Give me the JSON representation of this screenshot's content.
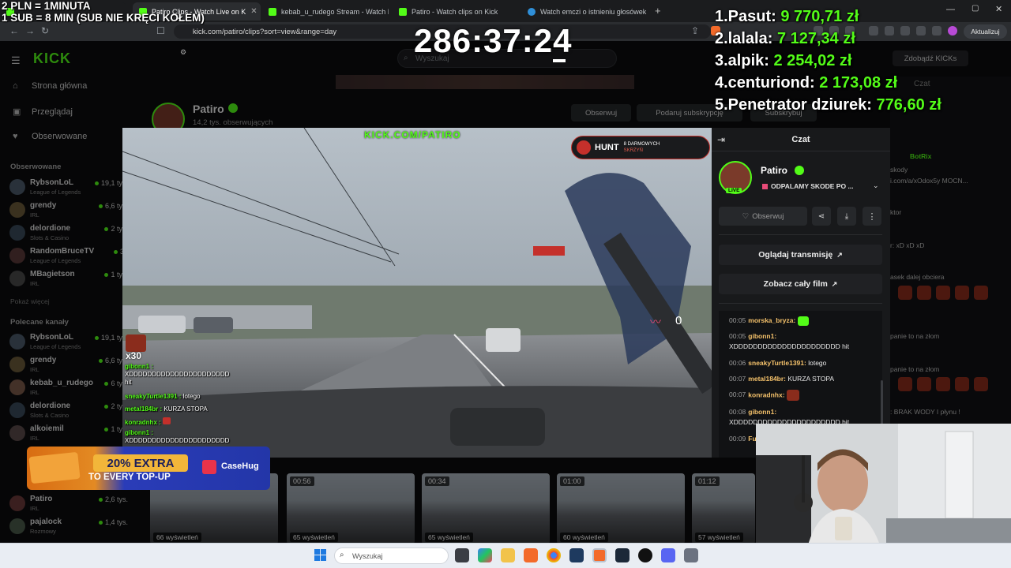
{
  "overlay": {
    "line1": "2 PLN =  1MINUTA",
    "line2": "1 SUB = 8 MIN (SUB NIE KRĘCI KOŁEM)",
    "timer": "286:37:24"
  },
  "leaderboard": [
    {
      "name": "1.Pasut:",
      "amount": "9 770,71 zł"
    },
    {
      "name": "2.lalala:",
      "amount": "7 127,34 zł"
    },
    {
      "name": "3.alpik:",
      "amount": "2 254,02 zł"
    },
    {
      "name": "4.centuriond:",
      "amount": "2 173,08 zł"
    },
    {
      "name": "5.Penetrator dziurek:",
      "amount": "776,60 zł"
    }
  ],
  "browser": {
    "tabs": [
      {
        "label": "Patiro Clips - Watch Live on K",
        "active": true
      },
      {
        "label": "kebab_u_rudego Stream - Watch Live",
        "active": false
      },
      {
        "label": "Patiro - Watch clips on Kick",
        "active": false
      },
      {
        "label": "Watch emczi o istnieniu głosówek | St",
        "active": false
      }
    ],
    "url": "kick.com/patiro/clips?sort=view&range=day",
    "update_label": "Aktualizuj"
  },
  "kick": {
    "logo": "KICK",
    "search_placeholder": "Wyszukaj",
    "nav": [
      {
        "label": "Strona główna",
        "icon": "home-icon"
      },
      {
        "label": "Przeglądaj",
        "icon": "browse-icon"
      },
      {
        "label": "Obserwowane",
        "icon": "heart-icon"
      }
    ],
    "followed_heading": "Obserwowane",
    "followed": [
      {
        "name": "RybsonLoL",
        "game": "League of Legends",
        "viewers": "19,1 tys."
      },
      {
        "name": "grendy",
        "game": "IRL",
        "viewers": "6,6 tys."
      },
      {
        "name": "delordione",
        "game": "Slots & Casino",
        "viewers": "2 tys."
      },
      {
        "name": "RandomBruceTV",
        "game": "League of Legends",
        "viewers": "31"
      },
      {
        "name": "MBagietson",
        "game": "IRL",
        "viewers": "1 tys."
      }
    ],
    "show_more": "Pokaż więcej",
    "recommended_heading": "Polecane kanały",
    "recommended": [
      {
        "name": "RybsonLoL",
        "game": "League of Legends",
        "viewers": "19,1 tys."
      },
      {
        "name": "grendy",
        "game": "IRL",
        "viewers": "6,6 tys."
      },
      {
        "name": "kebab_u_rudego",
        "game": "IRL",
        "viewers": "6 tys."
      },
      {
        "name": "delordione",
        "game": "Slots & Casino",
        "viewers": "2 tys."
      },
      {
        "name": "alkoiemil",
        "game": "IRL",
        "viewers": "1 tys."
      },
      {
        "name": "Patiro",
        "game": "IRL",
        "viewers": "2,6 tys."
      },
      {
        "name": "pajalock",
        "game": "Rozmowy",
        "viewers": "1,4 tys."
      }
    ],
    "streamer_name": "Patiro",
    "streamer_followers": "14,2 tys. obserwujących",
    "bg_follow": "Obserwuj",
    "bg_gift": "Podaruj subskrypcję",
    "bg_subscribe": "Subskrybuj",
    "get_kicks": "Zdobądź KICKs",
    "clips": [
      {
        "duration": "",
        "views": "66 wyświetleń"
      },
      {
        "duration": "00:56",
        "views": "65 wyświetleń"
      },
      {
        "duration": "00:34",
        "views": "65 wyświetleń"
      },
      {
        "duration": "01:00",
        "views": "60 wyświetleń"
      },
      {
        "duration": "01:12",
        "views": "57 wyświetleń"
      }
    ]
  },
  "clip_modal": {
    "watermark": "KICK.COM/PATIRO",
    "hunt_label": "HUNT",
    "hunt_sub1": "8 DARMOWYCH",
    "hunt_sub2": "SKRZYŃ",
    "pulse_count": "0",
    "x30": "x30",
    "panel_title": "Czat",
    "channel_name": "Patiro",
    "live_badge": "LIVE",
    "stream_title": "ODPALAMY SKODE PO ...",
    "follow_label": "Obserwuj",
    "watch_stream": "Oglądaj transmisję",
    "watch_full": "Zobacz cały film",
    "messages": [
      {
        "time": "00:05",
        "user": "morska_bryza:",
        "color": "#f5c26b",
        "text": ""
      },
      {
        "time": "00:05",
        "user": "gibonn1:",
        "color": "#f5c26b",
        "text": "XDDDDDDDDDDDDDDDDDDDDDD hit"
      },
      {
        "time": "00:06",
        "user": "sneakyTurtle1391:",
        "color": "#f5c26b",
        "text": "lotego"
      },
      {
        "time": "00:07",
        "user": "metal184br:",
        "color": "#f5c26b",
        "text": "KURZA STOPA"
      },
      {
        "time": "00:07",
        "user": "konradnhx:",
        "color": "#f5c26b",
        "text": ""
      },
      {
        "time": "00:08",
        "user": "gibonn1:",
        "color": "#f5c26b",
        "text": "XDDDDDDDDDDDDDDDDDDDDDD hit"
      },
      {
        "time": "00:09",
        "user": "Fu",
        "color": "#f5c26b",
        "text": ""
      }
    ],
    "overlay_chat": [
      {
        "user": "gibonn1 :",
        "color": "#53fc18",
        "text": "XDDDDDDDDDDDDDDDDDDDDDD hit"
      },
      {
        "user": "sneakyTurtle1391 :",
        "color": "#53fc18",
        "text": "lotego"
      },
      {
        "user": "metal184br :",
        "color": "#53fc18",
        "text": "KURZA STOPA"
      },
      {
        "user": "konradnhx :",
        "color": "#53fc18",
        "text": ""
      },
      {
        "user": "gibonn1 :",
        "color": "#53fc18",
        "text": "XDDDDDDDDDDDDDDDDDDDDDD"
      }
    ]
  },
  "bg_chat": [
    {
      "text": "Czat"
    },
    {
      "text": "BotRix"
    },
    {
      "text": "skody"
    },
    {
      "text": "i.com/a/xOdox5y MOCN..."
    },
    {
      "text": "ktor"
    },
    {
      "text": "r: xD xD xD"
    },
    {
      "text": "asek dalej obciera"
    },
    {
      "text": "panie to na złom"
    },
    {
      "text": "panie to na złom"
    },
    {
      "text": ": BRAK WODY I płynu !"
    }
  ],
  "casehug": {
    "line1": "20% EXTRA",
    "line2": "TO EVERY TOP-UP",
    "brand": "CaseHug"
  },
  "taskbar": {
    "search_placeholder": "Wyszukaj"
  },
  "colors": {
    "kick_green": "#53fc18",
    "panel_bg": "#18191b",
    "username_yellow": "#f5c26b"
  }
}
